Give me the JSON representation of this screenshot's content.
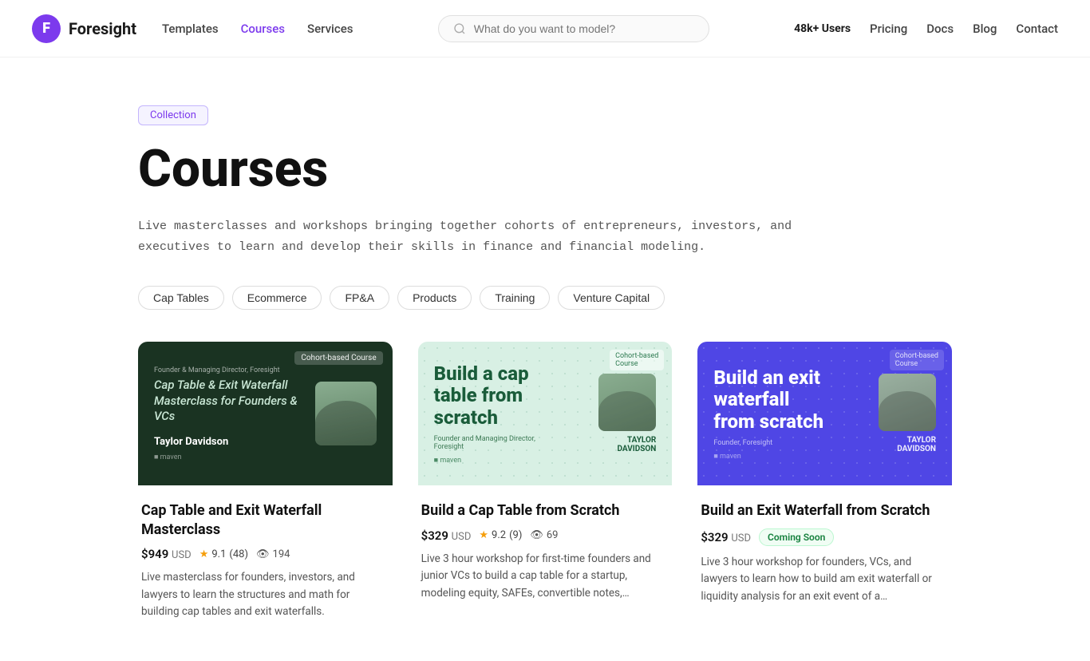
{
  "nav": {
    "logo_letter": "F",
    "logo_text": "Foresight",
    "links": [
      {
        "label": "Templates",
        "active": false
      },
      {
        "label": "Courses",
        "active": true
      },
      {
        "label": "Services",
        "active": false
      }
    ],
    "search_placeholder": "What do you want to model?",
    "users_badge": "48k+ Users",
    "right_links": [
      "Pricing",
      "Docs",
      "Blog",
      "Contact"
    ]
  },
  "page": {
    "badge": "Collection",
    "title": "Courses",
    "description": "Live masterclasses and workshops bringing together cohorts of entrepreneurs, investors,\nand executives to learn and develop their skills in finance and financial modeling.",
    "filters": [
      "Cap Tables",
      "Ecommerce",
      "FP&A",
      "Products",
      "Training",
      "Venture Capital"
    ]
  },
  "cards": [
    {
      "id": "card1",
      "badge": "Cohort-based Course",
      "title_overlay_line1": "Cap Table & Exit Waterfall",
      "title_overlay_line2": "Masterclass for Founders & VCs",
      "author_name": "Taylor Davidson",
      "author_role": "Founder & Managing\nDirector, Foresight",
      "maven_label": "■ maven",
      "title": "Cap Table and Exit Waterfall Masterclass",
      "price": "$949",
      "price_usd": "USD",
      "rating": "9.1",
      "rating_count": "(48)",
      "viewers": "194",
      "description": "Live masterclass for founders, investors, and lawyers to learn the structures and math for building cap tables and exit waterfalls.",
      "bg_color": "dark-green"
    },
    {
      "id": "card2",
      "badge": "Cohort-based\nCourse",
      "title_overlay": "Build a cap\ntable from\nscratch",
      "author_name": "TAYLOR\nDAVIDSON",
      "author_role": "Founder and Managing Director,\nForesight",
      "maven_label": "■ maven",
      "title": "Build a Cap Table from Scratch",
      "price": "$329",
      "price_usd": "USD",
      "rating": "9.2",
      "rating_count": "(9)",
      "viewers": "69",
      "description": "Live 3 hour workshop for first-time founders and junior VCs to build a cap table for a startup, modeling equity, SAFEs, convertible notes,…",
      "bg_color": "light-green"
    },
    {
      "id": "card3",
      "badge": "Cohort-based\nCourse",
      "title_overlay": "Build an exit\nwaterfall\nfrom scratch",
      "author_name": "TAYLOR\nDAVIDSON",
      "author_role": "Founder, Foresight",
      "maven_label": "■ maven",
      "title": "Build an Exit Waterfall from Scratch",
      "price": "$329",
      "price_usd": "USD",
      "coming_soon": "Coming Soon",
      "description": "Live 3 hour workshop for founders, VCs, and lawyers to learn how to build am exit waterfall or liquidity analysis for an exit event of a…",
      "bg_color": "blue"
    }
  ]
}
